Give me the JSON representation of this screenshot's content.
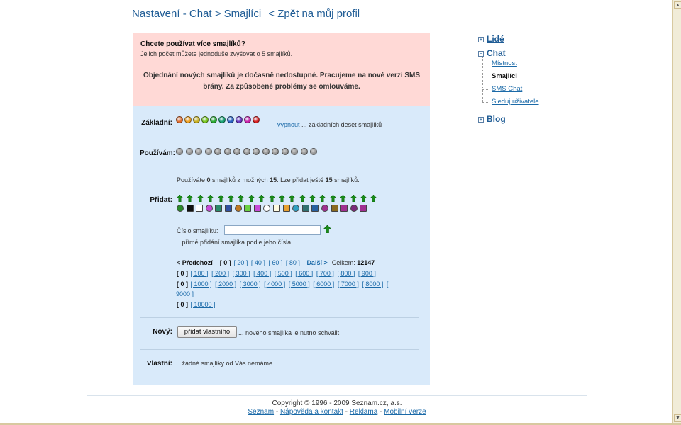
{
  "header": {
    "title": "Nastavení - Chat > Smajlíci",
    "back_link": "< Zpět na můj profil"
  },
  "notice": {
    "question": "Chcete používat více smajlíků?",
    "subtext": "Jejich počet můžete jednoduše zvyšovat o 5 smajlíků.",
    "warning": "Objednání nových smajlíků je dočasně nedostupné. Pracujeme na nové verzi SMS brány. Za způsobené problémy se omlouváme."
  },
  "basic": {
    "label": "Základní:",
    "disable_link": "vypnout",
    "disable_text": "... základních deset smajlíků",
    "colors": [
      "#e06a2a",
      "#f0a020",
      "#c8b020",
      "#7ac820",
      "#2aa830",
      "#18a070",
      "#2860c0",
      "#6a38c0",
      "#c820a8",
      "#d82020"
    ]
  },
  "using": {
    "label": "Používám:",
    "count": 15
  },
  "add": {
    "label": "Přidat:",
    "info_prefix": "Používáte ",
    "used": "0",
    "info_mid": " smajlíků z možných ",
    "max": "15",
    "info_mid2": ". Lze přidat ještě ",
    "remaining": "15",
    "info_suffix": " smajlíků.",
    "arrow_count": 20,
    "number_label": "Číslo smajlíku:",
    "number_value": "",
    "number_hint": "...přímé přidání smajlíka podle jeho čísla"
  },
  "paging": {
    "prev": "< Předchozí",
    "current": "[ 0 ]",
    "row1": [
      "[ 20 ]",
      "[ 40 ]",
      "[ 60 ]",
      "[ 80 ]"
    ],
    "next": "Další >",
    "total_label": "Celkem:",
    "total": "12147",
    "row2": [
      "[ 100 ]",
      "[ 200 ]",
      "[ 300 ]",
      "[ 400 ]",
      "[ 500 ]",
      "[ 600 ]",
      "[ 700 ]",
      "[ 800 ]",
      "[ 900 ]"
    ],
    "row3": [
      "[ 1000 ]",
      "[ 2000 ]",
      "[ 3000 ]",
      "[ 4000 ]",
      "[ 5000 ]",
      "[ 6000 ]",
      "[ 7000 ]",
      "[ 8000 ]",
      "["
    ],
    "row3b": "9000 ]",
    "row4": [
      "[ 10000 ]"
    ]
  },
  "new": {
    "label": "Nový:",
    "button": "přidat vlastního",
    "hint": "... nového smajlíka je nutno schválit"
  },
  "own": {
    "label": "Vlastní:",
    "text": "...žádné smajlíky od Vás nemáme"
  },
  "sidebar": {
    "lide": "Lidé",
    "chat": "Chat",
    "chat_items": [
      "Místnost",
      "Smajlíci",
      "SMS Chat",
      "Sleduj uživatele"
    ],
    "blog": "Blog"
  },
  "footer": {
    "copyright": "Copyright © 1996 - 2009 Seznam.cz, a.s.",
    "links": [
      "Seznam",
      "Nápověda a kontakt",
      "Reklama",
      "Mobilní verze"
    ],
    "separator": " - "
  }
}
